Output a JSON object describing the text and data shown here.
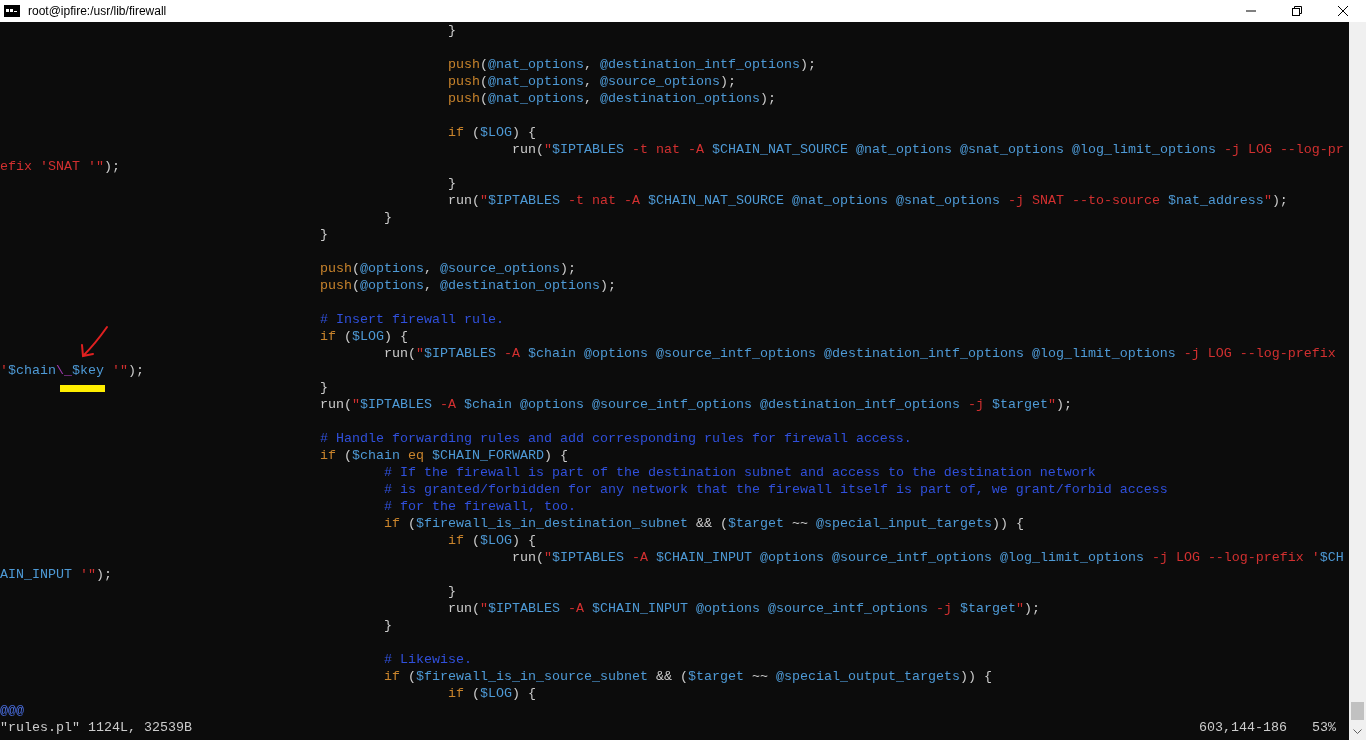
{
  "window": {
    "title": "root@ipfire:/usr/lib/firewall"
  },
  "editor": {
    "lines": [
      {
        "kind": "group",
        "children": [
          {
            "kind": "group",
            "children": [
              {
                "kind": "code",
                "parts": [
                  {
                    "kind": "plain",
                    "text": "}"
                  }
                ]
              },
              {
                "kind": "blank"
              },
              {
                "kind": "code",
                "parts": [
                  {
                    "kind": "keyword",
                    "text": "push"
                  },
                  {
                    "kind": "plain",
                    "text": "("
                  },
                  {
                    "kind": "variable",
                    "text": "@nat_options"
                  },
                  {
                    "kind": "plain",
                    "text": ", "
                  },
                  {
                    "kind": "variable",
                    "text": "@destination_intf_options"
                  },
                  {
                    "kind": "plain",
                    "text": ");"
                  }
                ]
              },
              {
                "kind": "code",
                "parts": [
                  {
                    "kind": "keyword",
                    "text": "push"
                  },
                  {
                    "kind": "plain",
                    "text": "("
                  },
                  {
                    "kind": "variable",
                    "text": "@nat_options"
                  },
                  {
                    "kind": "plain",
                    "text": ", "
                  },
                  {
                    "kind": "variable",
                    "text": "@source_options"
                  },
                  {
                    "kind": "plain",
                    "text": ");"
                  }
                ]
              },
              {
                "kind": "code",
                "parts": [
                  {
                    "kind": "keyword",
                    "text": "push"
                  },
                  {
                    "kind": "plain",
                    "text": "("
                  },
                  {
                    "kind": "variable",
                    "text": "@nat_options"
                  },
                  {
                    "kind": "plain",
                    "text": ", "
                  },
                  {
                    "kind": "variable",
                    "text": "@destination_options"
                  },
                  {
                    "kind": "plain",
                    "text": ");"
                  }
                ]
              },
              {
                "kind": "blank"
              },
              {
                "kind": "code",
                "parts": [
                  {
                    "kind": "keyword",
                    "text": "if"
                  },
                  {
                    "kind": "plain",
                    "text": " ("
                  },
                  {
                    "kind": "variable",
                    "text": "$LOG"
                  },
                  {
                    "kind": "plain",
                    "text": ") {"
                  }
                ],
                "children": [
                  {
                    "kind": "code",
                    "parts": [
                      {
                        "kind": "plain",
                        "text": "run("
                      },
                      {
                        "kind": "string",
                        "text": "\""
                      },
                      {
                        "kind": "variable",
                        "text": "$IPTABLES"
                      },
                      {
                        "kind": "string",
                        "text": " -t nat -A "
                      },
                      {
                        "kind": "variable",
                        "text": "$CHAIN_NAT_SOURCE"
                      },
                      {
                        "kind": "variable",
                        "text": " @nat_options"
                      },
                      {
                        "kind": "variable",
                        "text": " @snat_options"
                      },
                      {
                        "kind": "variable",
                        "text": " @log_limit_options"
                      },
                      {
                        "kind": "string",
                        "text": " -j LOG --log-pr"
                      }
                    ]
                  },
                  {
                    "kind": "wrap",
                    "parts": [
                      {
                        "kind": "string",
                        "text": "efix 'SNAT '\""
                      },
                      {
                        "kind": "plain",
                        "text": ");"
                      }
                    ]
                  }
                ]
              },
              {
                "kind": "code",
                "parts": [
                  {
                    "kind": "plain",
                    "text": "}"
                  }
                ]
              },
              {
                "kind": "code",
                "parts": [
                  {
                    "kind": "plain",
                    "text": "run("
                  },
                  {
                    "kind": "string",
                    "text": "\""
                  },
                  {
                    "kind": "variable",
                    "text": "$IPTABLES"
                  },
                  {
                    "kind": "string",
                    "text": " -t nat -A "
                  },
                  {
                    "kind": "variable",
                    "text": "$CHAIN_NAT_SOURCE"
                  },
                  {
                    "kind": "variable",
                    "text": " @nat_options"
                  },
                  {
                    "kind": "variable",
                    "text": " @snat_options"
                  },
                  {
                    "kind": "string",
                    "text": " -j SNAT --to-source "
                  },
                  {
                    "kind": "variable",
                    "text": "$nat_address"
                  },
                  {
                    "kind": "string",
                    "text": "\""
                  },
                  {
                    "kind": "plain",
                    "text": ");"
                  }
                ]
              }
            ]
          },
          {
            "kind": "code",
            "parts": [
              {
                "kind": "plain",
                "text": "}"
              }
            ]
          }
        ]
      },
      {
        "kind": "code",
        "parts": [
          {
            "kind": "plain",
            "text": "}"
          }
        ]
      },
      {
        "kind": "blank"
      },
      {
        "kind": "code",
        "parts": [
          {
            "kind": "keyword",
            "text": "push"
          },
          {
            "kind": "plain",
            "text": "("
          },
          {
            "kind": "variable",
            "text": "@options"
          },
          {
            "kind": "plain",
            "text": ", "
          },
          {
            "kind": "variable",
            "text": "@source_options"
          },
          {
            "kind": "plain",
            "text": ");"
          }
        ]
      },
      {
        "kind": "code",
        "parts": [
          {
            "kind": "keyword",
            "text": "push"
          },
          {
            "kind": "plain",
            "text": "("
          },
          {
            "kind": "variable",
            "text": "@options"
          },
          {
            "kind": "plain",
            "text": ", "
          },
          {
            "kind": "variable",
            "text": "@destination_options"
          },
          {
            "kind": "plain",
            "text": ");"
          }
        ]
      },
      {
        "kind": "blank"
      },
      {
        "kind": "code",
        "parts": [
          {
            "kind": "comment",
            "text": "# Insert firewall rule."
          }
        ]
      },
      {
        "kind": "code",
        "parts": [
          {
            "kind": "keyword",
            "text": "if"
          },
          {
            "kind": "plain",
            "text": " ("
          },
          {
            "kind": "variable",
            "text": "$LOG"
          },
          {
            "kind": "plain",
            "text": ") {"
          }
        ],
        "children": [
          {
            "kind": "code",
            "parts": [
              {
                "kind": "plain",
                "text": "run("
              },
              {
                "kind": "string",
                "text": "\""
              },
              {
                "kind": "variable",
                "text": "$IPTABLES"
              },
              {
                "kind": "string",
                "text": " -A "
              },
              {
                "kind": "variable",
                "text": "$chain"
              },
              {
                "kind": "variable",
                "text": " @options"
              },
              {
                "kind": "variable",
                "text": " @source_intf_options"
              },
              {
                "kind": "variable",
                "text": " @destination_intf_options"
              },
              {
                "kind": "variable",
                "text": " @log_limit_options"
              },
              {
                "kind": "string",
                "text": " -j LOG --log-prefix"
              }
            ]
          },
          {
            "kind": "wrap",
            "parts": [
              {
                "kind": "string",
                "text": "'"
              },
              {
                "kind": "variable",
                "text": "$chain"
              },
              {
                "kind": "escape",
                "text": "\\_"
              },
              {
                "kind": "variable",
                "text": "$key"
              },
              {
                "kind": "string",
                "text": " '\""
              },
              {
                "kind": "plain",
                "text": ");"
              }
            ]
          }
        ]
      },
      {
        "kind": "code",
        "parts": [
          {
            "kind": "plain",
            "text": "}"
          }
        ]
      },
      {
        "kind": "code",
        "parts": [
          {
            "kind": "plain",
            "text": "run("
          },
          {
            "kind": "string",
            "text": "\""
          },
          {
            "kind": "variable",
            "text": "$IPTABLES"
          },
          {
            "kind": "string",
            "text": " -A "
          },
          {
            "kind": "variable",
            "text": "$chain"
          },
          {
            "kind": "variable",
            "text": " @options"
          },
          {
            "kind": "variable",
            "text": " @source_intf_options"
          },
          {
            "kind": "variable",
            "text": " @destination_intf_options"
          },
          {
            "kind": "string",
            "text": " -j "
          },
          {
            "kind": "variable",
            "text": "$target"
          },
          {
            "kind": "string",
            "text": "\""
          },
          {
            "kind": "plain",
            "text": ");"
          }
        ]
      },
      {
        "kind": "blank"
      },
      {
        "kind": "code",
        "parts": [
          {
            "kind": "comment",
            "text": "# Handle forwarding rules and add corresponding rules for firewall access."
          }
        ]
      },
      {
        "kind": "code",
        "parts": [
          {
            "kind": "keyword",
            "text": "if"
          },
          {
            "kind": "plain",
            "text": " ("
          },
          {
            "kind": "variable",
            "text": "$chain"
          },
          {
            "kind": "keyword",
            "text": " eq"
          },
          {
            "kind": "variable",
            "text": " $CHAIN_FORWARD"
          },
          {
            "kind": "plain",
            "text": ") {"
          }
        ],
        "children": [
          {
            "kind": "code",
            "parts": [
              {
                "kind": "comment",
                "text": "# If the firewall is part of the destination subnet and access to the destination network"
              }
            ]
          },
          {
            "kind": "code",
            "parts": [
              {
                "kind": "comment",
                "text": "# is granted/forbidden for any network that the firewall itself is part of, we grant/forbid access"
              }
            ]
          },
          {
            "kind": "code",
            "parts": [
              {
                "kind": "comment",
                "text": "# for the firewall, too."
              }
            ]
          },
          {
            "kind": "code",
            "parts": [
              {
                "kind": "keyword",
                "text": "if"
              },
              {
                "kind": "plain",
                "text": " ("
              },
              {
                "kind": "variable",
                "text": "$firewall_is_in_destination_subnet"
              },
              {
                "kind": "plain",
                "text": " && ("
              },
              {
                "kind": "variable",
                "text": "$target"
              },
              {
                "kind": "plain",
                "text": " ~~ "
              },
              {
                "kind": "variable",
                "text": "@special_input_targets"
              },
              {
                "kind": "plain",
                "text": ")) {"
              }
            ],
            "children": [
              {
                "kind": "code",
                "parts": [
                  {
                    "kind": "keyword",
                    "text": "if"
                  },
                  {
                    "kind": "plain",
                    "text": " ("
                  },
                  {
                    "kind": "variable",
                    "text": "$LOG"
                  },
                  {
                    "kind": "plain",
                    "text": ") {"
                  }
                ],
                "children": [
                  {
                    "kind": "code",
                    "parts": [
                      {
                        "kind": "plain",
                        "text": "run("
                      },
                      {
                        "kind": "string",
                        "text": "\""
                      },
                      {
                        "kind": "variable",
                        "text": "$IPTABLES"
                      },
                      {
                        "kind": "string",
                        "text": " -A "
                      },
                      {
                        "kind": "variable",
                        "text": "$CHAIN_INPUT"
                      },
                      {
                        "kind": "variable",
                        "text": " @options"
                      },
                      {
                        "kind": "variable",
                        "text": " @source_intf_options"
                      },
                      {
                        "kind": "variable",
                        "text": " @log_limit_options"
                      },
                      {
                        "kind": "string",
                        "text": " -j LOG --log-prefix '"
                      },
                      {
                        "kind": "variable",
                        "text": "$CH"
                      }
                    ]
                  },
                  {
                    "kind": "wrap",
                    "parts": [
                      {
                        "kind": "variable",
                        "text": "AIN_INPUT"
                      },
                      {
                        "kind": "string",
                        "text": " '\""
                      },
                      {
                        "kind": "plain",
                        "text": ");"
                      }
                    ]
                  }
                ]
              },
              {
                "kind": "code",
                "parts": [
                  {
                    "kind": "plain",
                    "text": "}"
                  }
                ]
              },
              {
                "kind": "code",
                "parts": [
                  {
                    "kind": "plain",
                    "text": "run("
                  },
                  {
                    "kind": "string",
                    "text": "\""
                  },
                  {
                    "kind": "variable",
                    "text": "$IPTABLES"
                  },
                  {
                    "kind": "string",
                    "text": " -A "
                  },
                  {
                    "kind": "variable",
                    "text": "$CHAIN_INPUT"
                  },
                  {
                    "kind": "variable",
                    "text": " @options"
                  },
                  {
                    "kind": "variable",
                    "text": " @source_intf_options"
                  },
                  {
                    "kind": "string",
                    "text": " -j "
                  },
                  {
                    "kind": "variable",
                    "text": "$target"
                  },
                  {
                    "kind": "string",
                    "text": "\""
                  },
                  {
                    "kind": "plain",
                    "text": ");"
                  }
                ]
              }
            ]
          },
          {
            "kind": "code",
            "parts": [
              {
                "kind": "plain",
                "text": "}"
              }
            ]
          },
          {
            "kind": "blank"
          },
          {
            "kind": "code",
            "parts": [
              {
                "kind": "comment",
                "text": "# Likewise."
              }
            ]
          },
          {
            "kind": "code",
            "parts": [
              {
                "kind": "keyword",
                "text": "if"
              },
              {
                "kind": "plain",
                "text": " ("
              },
              {
                "kind": "variable",
                "text": "$firewall_is_in_source_subnet"
              },
              {
                "kind": "plain",
                "text": " && ("
              },
              {
                "kind": "variable",
                "text": "$target"
              },
              {
                "kind": "plain",
                "text": " ~~ "
              },
              {
                "kind": "variable",
                "text": "@special_output_targets"
              },
              {
                "kind": "plain",
                "text": ")) {"
              }
            ],
            "children": [
              {
                "kind": "code",
                "parts": [
                  {
                    "kind": "keyword",
                    "text": "if"
                  },
                  {
                    "kind": "plain",
                    "text": " ("
                  },
                  {
                    "kind": "variable",
                    "text": "$LOG"
                  },
                  {
                    "kind": "plain",
                    "text": ") {"
                  }
                ]
              }
            ]
          }
        ]
      },
      {
        "kind": "marker",
        "parts": [
          {
            "kind": "marker",
            "text": "@@@"
          }
        ]
      }
    ]
  },
  "status_bar": {
    "file_info": "\"rules.pl\" 1124L, 32539B",
    "position": "603,144-186",
    "scroll_percent": "53%"
  }
}
